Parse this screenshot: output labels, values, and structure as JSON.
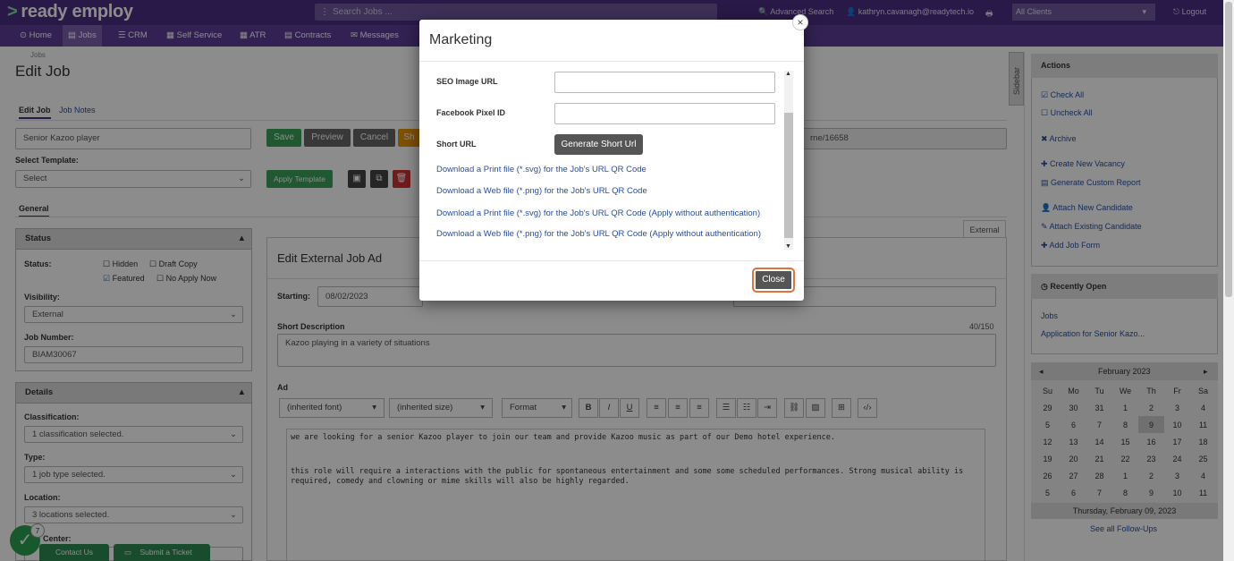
{
  "app": {
    "logo": "ready employ",
    "search_placeholder": "Search Jobs ...",
    "advanced_search": "Advanced Search",
    "user_email": "kathryn.cavanagh@readytech.io",
    "clients_select": "All Clients",
    "logout": "Logout"
  },
  "nav": [
    "Home",
    "Jobs",
    "CRM",
    "Self Service",
    "ATR",
    "Contracts",
    "Messages"
  ],
  "page": {
    "breadcrumb": "Jobs",
    "title": "Edit Job",
    "tabs": [
      "Edit Job",
      "Job Notes"
    ],
    "job_title_value": "Senior Kazoo player",
    "select_template_label": "Select Template:",
    "template_value": "Select",
    "url_fragment": "rne/16658"
  },
  "toolbar": {
    "save": "Save",
    "preview": "Preview",
    "cancel": "Cancel",
    "share": "Sh",
    "apply_template": "Apply Template"
  },
  "general_tab": "General",
  "status_panel": {
    "header": "Status",
    "status_label": "Status:",
    "checks": [
      {
        "label": "Hidden",
        "checked": false
      },
      {
        "label": "Draft Copy",
        "checked": false
      },
      {
        "label": "Featured",
        "checked": true
      },
      {
        "label": "No Apply Now",
        "checked": false
      }
    ],
    "visibility_label": "Visibility:",
    "visibility_value": "External",
    "job_number_label": "Job Number:",
    "job_number_value": "BIAM30067"
  },
  "details_panel": {
    "header": "Details",
    "classification_label": "Classification:",
    "classification_value": "1 classification selected.",
    "type_label": "Type:",
    "type_value": "1 job type selected.",
    "location_label": "Location:",
    "location_value": "3 locations selected.",
    "cost_center_label": "Center:"
  },
  "editor": {
    "external_tab": "External",
    "header": "Edit External Job Ad",
    "starting_label": "Starting:",
    "starting_value": "08/02/2023",
    "short_desc_label": "Short Description",
    "short_desc_count": "40/150",
    "short_desc_value": "Kazoo playing in a variety of situations",
    "ad_label": "Ad",
    "font_select": "(inherited font)",
    "size_select": "(inherited size)",
    "format_select": "Format",
    "ad_line1": "we are looking for a senior Kazoo player to join our team and provide Kazoo music as part of our Demo hotel experience.",
    "ad_line2": "this role will require a interactions with the public for spontaneous entertainment and some some scheduled performances. Strong musical ability is required, comedy and clowning or mime skills will also be highly regarded."
  },
  "sidebar_tab": "Sidebar",
  "actions": {
    "header": "Actions",
    "items": [
      "Check All",
      "Uncheck All",
      "Archive",
      "Create New Vacancy",
      "Generate Custom Report",
      "Attach New Candidate",
      "Attach Existing Candidate",
      "Add Job Form"
    ]
  },
  "recent": {
    "header": "Recently Open",
    "items": [
      "Jobs",
      "Application for Senior Kazo..."
    ]
  },
  "calendar": {
    "month": "February 2023",
    "days": [
      "Su",
      "Mo",
      "Tu",
      "We",
      "Th",
      "Fr",
      "Sa"
    ],
    "weeks": [
      [
        "29",
        "30",
        "31",
        "1",
        "2",
        "3",
        "4"
      ],
      [
        "5",
        "6",
        "7",
        "8",
        "9",
        "10",
        "11"
      ],
      [
        "12",
        "13",
        "14",
        "15",
        "16",
        "17",
        "18"
      ],
      [
        "19",
        "20",
        "21",
        "22",
        "23",
        "24",
        "25"
      ],
      [
        "26",
        "27",
        "28",
        "1",
        "2",
        "3",
        "4"
      ],
      [
        "5",
        "6",
        "7",
        "8",
        "9",
        "10",
        "11"
      ]
    ],
    "today_label": "Thursday, February 09, 2023",
    "follow_ups": "See all Follow-Ups"
  },
  "footer": {
    "badge": "7",
    "contact": "Contact Us",
    "ticket": "Submit a Ticket"
  },
  "modal": {
    "title": "Marketing",
    "seo_label": "SEO Image URL",
    "seo_value": "",
    "fb_label": "Facebook Pixel ID",
    "fb_value": "",
    "short_url_label": "Short URL",
    "generate_button": "Generate Short Url",
    "links": [
      "Download a Print file (*.svg) for the Job's URL QR Code",
      "Download a Web file (*.png) for the Job's URL QR Code",
      "Download a Print file (*.svg) for the Job's URL QR Code (Apply without authentication)",
      "Download a Web file (*.png) for the Job's URL QR Code (Apply without authentication)"
    ],
    "close_button": "Close"
  },
  "colors": {
    "topbar": "#4b2e83",
    "accent_green": "#3aa05a",
    "link": "#2a4fa0",
    "highlight": "#e8703a"
  }
}
